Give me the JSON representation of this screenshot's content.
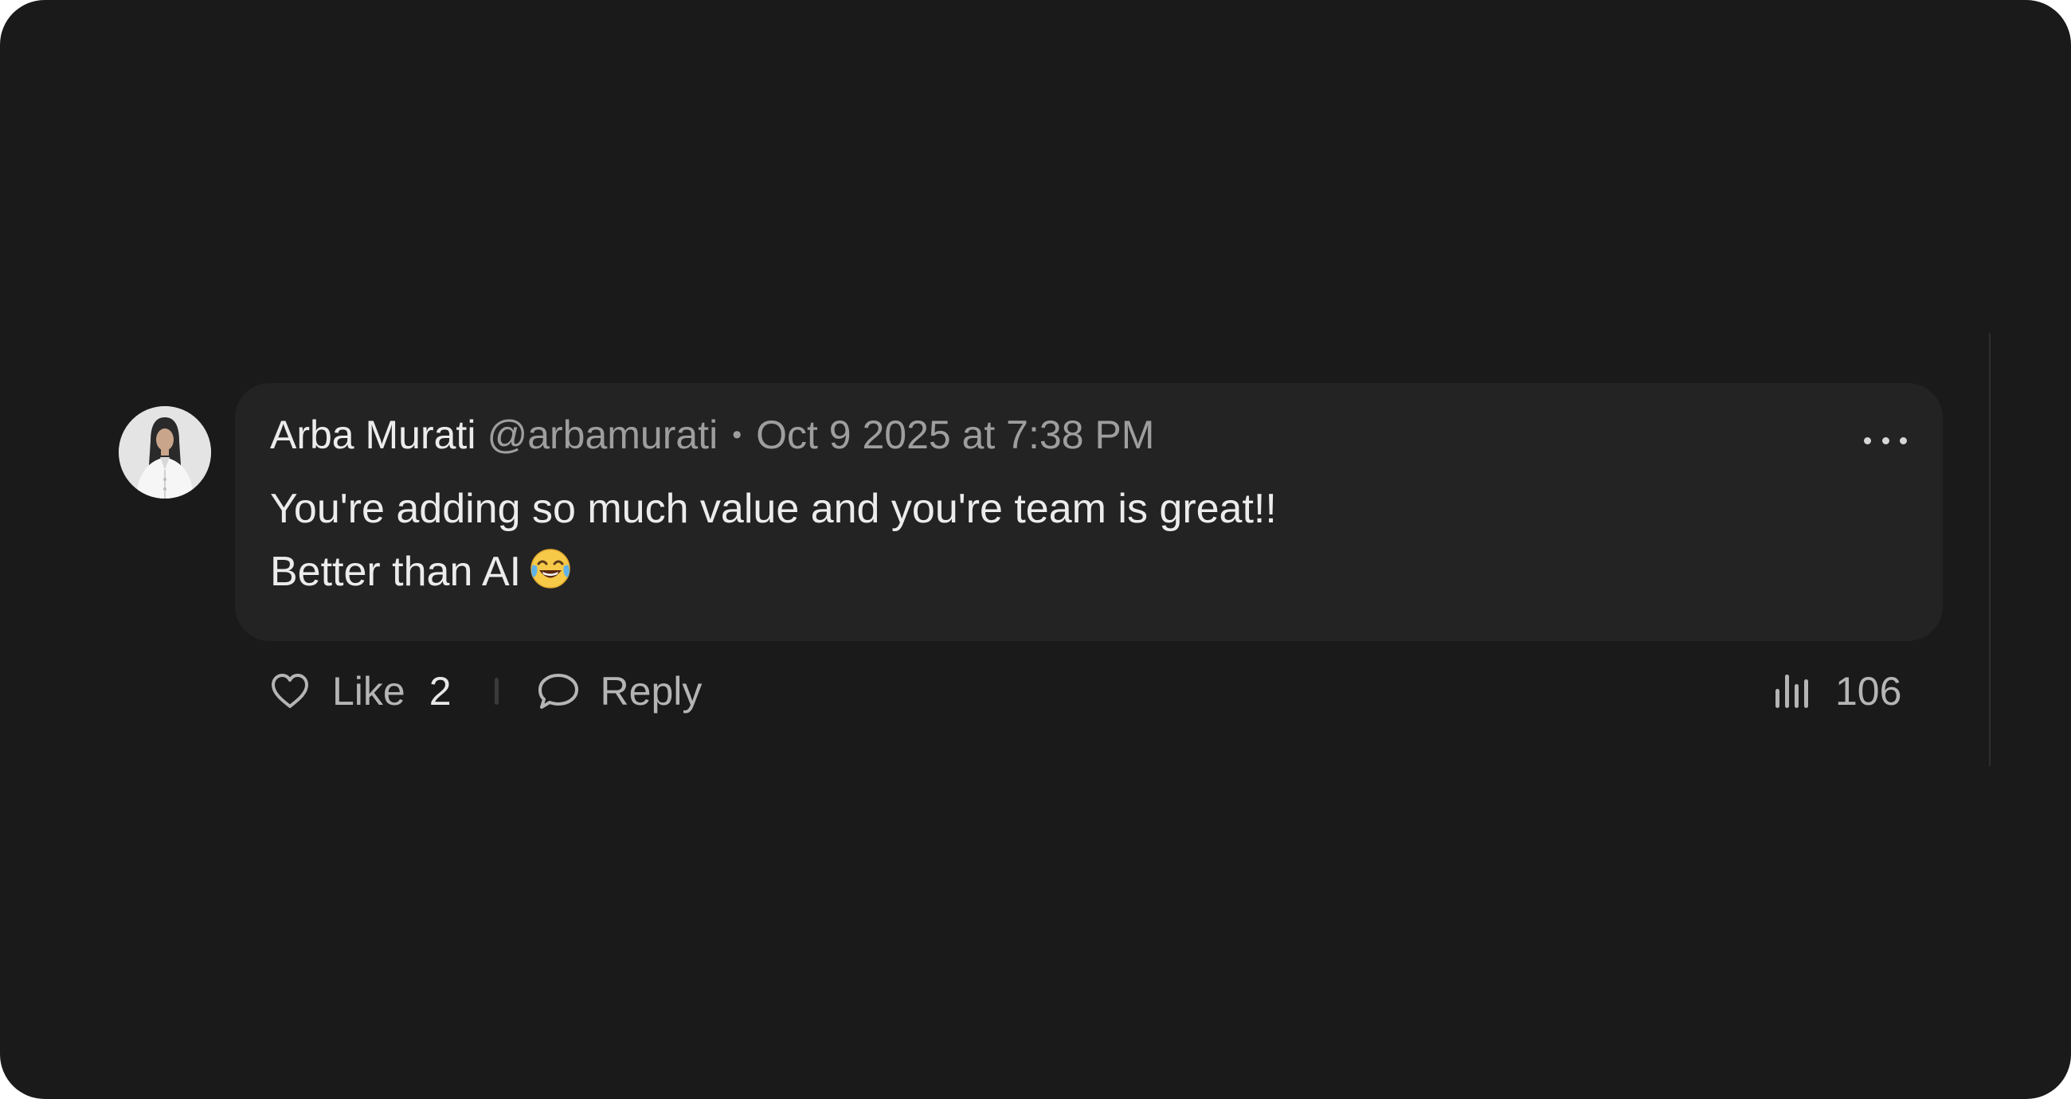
{
  "comment": {
    "author_name": "Arba Murati",
    "handle": "@arbamurati",
    "separator": "•",
    "timestamp": "Oct 9 2025 at 7:38 PM",
    "body_lines": [
      "You're adding so much value and you're team is great!!",
      "Better than AI"
    ],
    "body_emoji": "face-with-tears-of-joy-emoji",
    "more_icon": "ellipsis-horizontal-icon",
    "avatar": "user-avatar-photo"
  },
  "actions": {
    "like_icon": "heart-outline-icon",
    "like_label": "Like",
    "like_count": "2",
    "reply_icon": "speech-bubble-icon",
    "reply_label": "Reply",
    "views_icon": "bar-chart-icon",
    "views_count": "106"
  },
  "colors": {
    "background": "#1a1a1a",
    "bubble": "#232323",
    "text_primary": "#ececec",
    "text_secondary": "#9e9e9e"
  }
}
